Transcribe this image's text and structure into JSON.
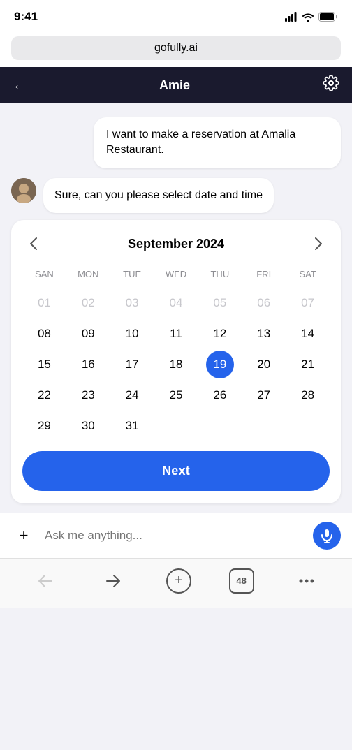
{
  "statusBar": {
    "time": "9:41",
    "signalIcon": "signal-icon",
    "wifiIcon": "wifi-icon",
    "batteryIcon": "battery-icon"
  },
  "urlBar": {
    "url": "gofully.ai"
  },
  "navBar": {
    "backLabel": "←",
    "title": "Amie",
    "settingsIcon": "settings-icon"
  },
  "chat": {
    "userMessage": "I want to make a reservation at Amalia Restaurant.",
    "botMessage": "Sure, can you please select date and time"
  },
  "calendar": {
    "prevIcon": "chevron-left-icon",
    "nextIcon": "chevron-right-icon",
    "monthTitle": "September 2024",
    "weekdays": [
      "SAN",
      "MON",
      "TUE",
      "WED",
      "THU",
      "FRI",
      "SAT"
    ],
    "selectedDay": 19,
    "weeks": [
      [
        {
          "day": "01",
          "inactive": true
        },
        {
          "day": "02",
          "inactive": true
        },
        {
          "day": "03",
          "inactive": true
        },
        {
          "day": "04",
          "inactive": true
        },
        {
          "day": "05",
          "inactive": true
        },
        {
          "day": "06",
          "inactive": true
        },
        {
          "day": "07",
          "inactive": true
        }
      ],
      [
        {
          "day": "08",
          "inactive": false
        },
        {
          "day": "09",
          "inactive": false
        },
        {
          "day": "10",
          "inactive": false
        },
        {
          "day": "11",
          "inactive": false
        },
        {
          "day": "12",
          "inactive": false
        },
        {
          "day": "13",
          "inactive": false
        },
        {
          "day": "14",
          "inactive": false
        }
      ],
      [
        {
          "day": "15",
          "inactive": false
        },
        {
          "day": "16",
          "inactive": false
        },
        {
          "day": "17",
          "inactive": false
        },
        {
          "day": "18",
          "inactive": false
        },
        {
          "day": "19",
          "inactive": false,
          "selected": true
        },
        {
          "day": "20",
          "inactive": false
        },
        {
          "day": "21",
          "inactive": false
        }
      ],
      [
        {
          "day": "22",
          "inactive": false
        },
        {
          "day": "23",
          "inactive": false
        },
        {
          "day": "24",
          "inactive": false
        },
        {
          "day": "25",
          "inactive": false
        },
        {
          "day": "26",
          "inactive": false
        },
        {
          "day": "27",
          "inactive": false
        },
        {
          "day": "28",
          "inactive": false
        }
      ],
      [
        {
          "day": "29",
          "inactive": false
        },
        {
          "day": "30",
          "inactive": false
        },
        {
          "day": "31",
          "inactive": false
        },
        {
          "day": "",
          "inactive": true
        },
        {
          "day": "",
          "inactive": true
        },
        {
          "day": "",
          "inactive": true
        },
        {
          "day": "",
          "inactive": true
        }
      ]
    ],
    "nextButtonLabel": "Next"
  },
  "inputBar": {
    "addIcon": "plus-icon",
    "placeholder": "Ask me anything...",
    "voiceIcon": "microphone-icon"
  },
  "browserNav": {
    "backIcon": "arrow-left-icon",
    "forwardIcon": "arrow-right-icon",
    "newTabIcon": "plus-icon",
    "tabsCount": "48",
    "moreIcon": "ellipsis-icon"
  }
}
